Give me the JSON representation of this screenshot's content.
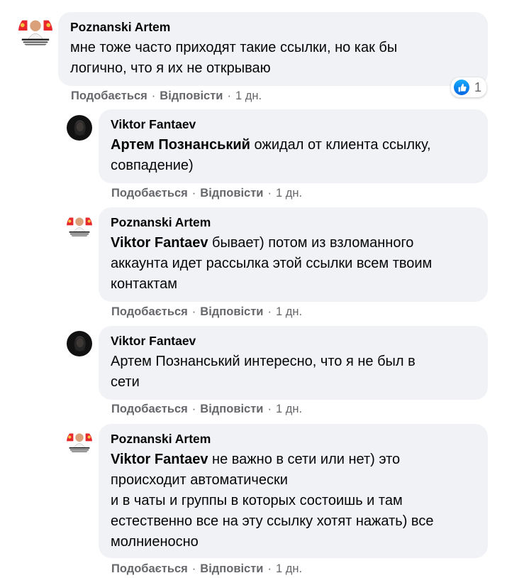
{
  "comments": [
    {
      "author": "Poznanski Artem",
      "mention": "",
      "text": "мне тоже часто приходят такие ссылки, но как бы\nлогично, что я их не открываю",
      "like_label": "Подобається",
      "reply_label": "Відповісти",
      "time": "1 дн.",
      "reaction_count": "1",
      "reaction_icon": "like-icon"
    },
    {
      "author": "Viktor Fantaev",
      "mention": "Артем Познанський",
      "text": " ожидал от клиента ссылку,\nсовпадение)",
      "like_label": "Подобається",
      "reply_label": "Відповісти",
      "time": "1 дн."
    },
    {
      "author": "Poznanski Artem",
      "mention": "Viktor Fantaev",
      "text": " бывает) потом из взломанного\nаккаунта идет рассылка этой ссылки всем твоим\nконтактам",
      "like_label": "Подобається",
      "reply_label": "Відповісти",
      "time": "1 дн."
    },
    {
      "author": "Viktor Fantaev",
      "mention": "",
      "text": "Артем Познанський интересно, что я не был в\nсети",
      "like_label": "Подобається",
      "reply_label": "Відповісти",
      "time": "1 дн."
    },
    {
      "author": "Poznanski Artem",
      "mention": "Viktor Fantaev",
      "text": " не важно в сети или нет) это\nпроисходит автоматически\nи в чаты и группы в которых состоишь и там\nестественно все на эту ссылку хотят нажать) все\nмолниеносно",
      "like_label": "Подобається",
      "reply_label": "Відповісти",
      "time": "1 дн."
    }
  ],
  "separator": "·",
  "colors": {
    "bubble": "#f0f2f5",
    "meta": "#65676b",
    "text": "#050505",
    "like_blue": "#0165e1"
  }
}
